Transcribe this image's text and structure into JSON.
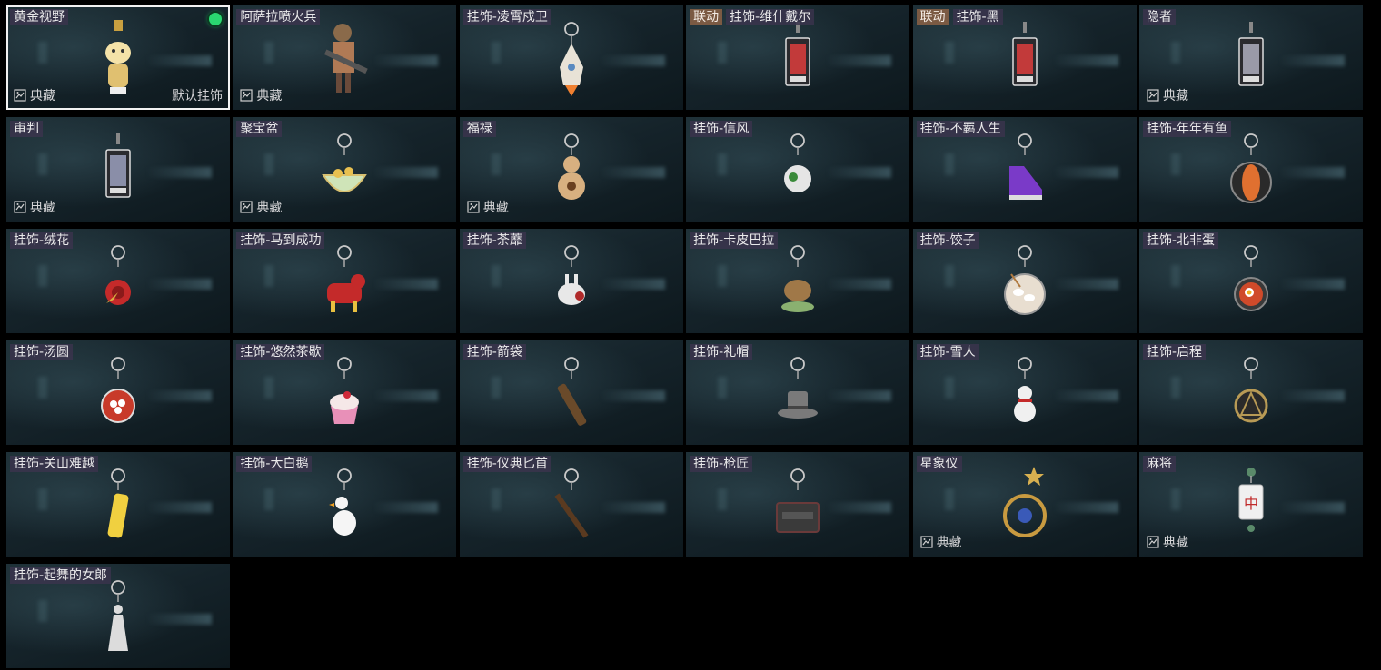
{
  "collect_label": "典藏",
  "default_label": "默认挂饰",
  "collab_tag": "联动",
  "items": [
    {
      "name": "黄金视野",
      "collector": true,
      "selected": true,
      "equipped": true,
      "icon": "cat-mascot-icon",
      "color": "#e0c070"
    },
    {
      "name": "阿萨拉喷火兵",
      "collector": true,
      "icon": "flamethrower-soldier-icon",
      "color": "#b07a55"
    },
    {
      "name": "挂饰-凌霄戍卫",
      "icon": "rocket-icon",
      "color": "#e8e2d6"
    },
    {
      "name": "挂饰-维什戴尔",
      "collab": true,
      "icon": "tarot-card-icon",
      "color": "#c23a3a"
    },
    {
      "name": "挂饰-黑",
      "collab": true,
      "icon": "tarot-card-icon",
      "color": "#c23a3a"
    },
    {
      "name": "隐者",
      "collector": true,
      "icon": "tarot-card-icon",
      "color": "#9a9aa8"
    },
    {
      "name": "审判",
      "collector": true,
      "icon": "tarot-card-icon",
      "color": "#8a8ea8"
    },
    {
      "name": "聚宝盆",
      "collector": true,
      "icon": "treasure-bowl-icon",
      "color": "#cfe4b8"
    },
    {
      "name": "福禄",
      "collector": true,
      "icon": "gourd-icon",
      "color": "#d8b080"
    },
    {
      "name": "挂饰-信风",
      "icon": "ball-icon",
      "color": "#e5e5e5"
    },
    {
      "name": "挂饰-不羁人生",
      "icon": "sneaker-icon",
      "color": "#7a3ac8"
    },
    {
      "name": "挂饰-年年有鱼",
      "icon": "fish-icon",
      "color": "#e07030"
    },
    {
      "name": "挂饰-绒花",
      "icon": "flower-icon",
      "color": "#c42a2a"
    },
    {
      "name": "挂饰-马到成功",
      "icon": "horse-icon",
      "color": "#c42a2a"
    },
    {
      "name": "挂饰-荼蘼",
      "icon": "bunny-icon",
      "color": "#e8e8e8"
    },
    {
      "name": "挂饰-卡皮巴拉",
      "icon": "capybara-icon",
      "color": "#a07848"
    },
    {
      "name": "挂饰-饺子",
      "icon": "dumpling-plate-icon",
      "color": "#e8ded0"
    },
    {
      "name": "挂饰-北非蛋",
      "icon": "pan-icon",
      "color": "#d04a2a"
    },
    {
      "name": "挂饰-汤圆",
      "icon": "bowl-icon",
      "color": "#c83a2a"
    },
    {
      "name": "挂饰-悠然茶歇",
      "icon": "cupcake-icon",
      "color": "#e890b8"
    },
    {
      "name": "挂饰-箭袋",
      "icon": "quiver-icon",
      "color": "#6a4a2a"
    },
    {
      "name": "挂饰-礼帽",
      "icon": "top-hat-icon",
      "color": "#7a7a7a"
    },
    {
      "name": "挂饰-雪人",
      "icon": "snowman-icon",
      "color": "#f0f0f0"
    },
    {
      "name": "挂饰-启程",
      "icon": "compass-medal-icon",
      "color": "#b89a55"
    },
    {
      "name": "挂饰-关山难越",
      "icon": "glowstick-icon",
      "color": "#f0d040"
    },
    {
      "name": "挂饰-大白鹅",
      "icon": "goose-icon",
      "color": "#f5f5f5"
    },
    {
      "name": "挂饰-仪典匕首",
      "icon": "dagger-icon",
      "color": "#5a3a20"
    },
    {
      "name": "挂饰-枪匠",
      "icon": "toolbox-icon",
      "color": "#6a3a3a"
    },
    {
      "name": "星象仪",
      "collector": true,
      "icon": "astrolabe-icon",
      "color": "#c89a40"
    },
    {
      "name": "麻将",
      "collector": true,
      "icon": "mahjong-tile-icon",
      "color": "#f0f0f0"
    },
    {
      "name": "挂饰-起舞的女郎",
      "icon": "dancer-icon",
      "color": "#dcdcdc"
    }
  ]
}
